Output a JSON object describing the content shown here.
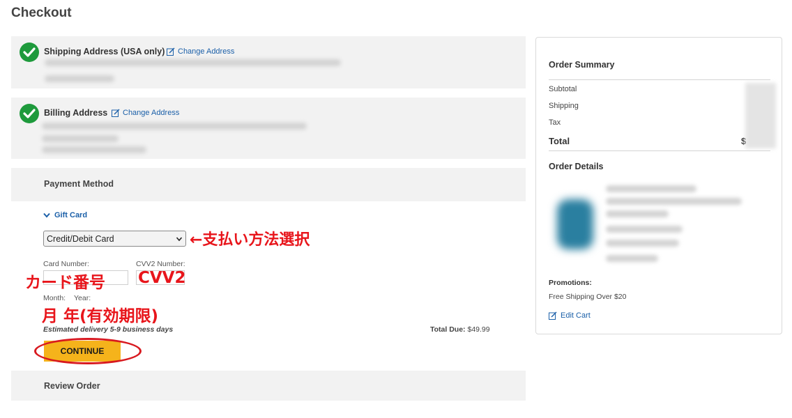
{
  "page": {
    "title": "Checkout"
  },
  "shipping": {
    "title": "Shipping Address (USA only)",
    "change_label": "Change Address"
  },
  "billing": {
    "title": "Billing Address",
    "change_label": "Change Address"
  },
  "payment": {
    "title": "Payment Method",
    "gift_card_label": "Gift Card",
    "method_selected": "Credit/Debit Card",
    "card_number_label": "Card Number:",
    "cvv_label": "CVV2 Number:",
    "month_label": "Month:",
    "year_label": "Year:",
    "delivery_note": "Estimated delivery 5-9 business days",
    "total_due_label": "Total Due:",
    "total_due_value": "$49.99",
    "continue_label": "CONTINUE"
  },
  "review": {
    "title": "Review Order"
  },
  "summary": {
    "title": "Order Summary",
    "subtotal_label": "Subtotal",
    "shipping_label": "Shipping",
    "tax_label": "Tax",
    "total_label": "Total",
    "total_value_partial": "$",
    "order_details_title": "Order Details",
    "promotions_label": "Promotions:",
    "promotion_value": "Free Shipping Over $20",
    "edit_cart_label": "Edit Cart"
  },
  "annotations": {
    "payment_select": "←支払い方法選択",
    "card_number": "カード番号",
    "cvv": "CVV2",
    "expiry": "月 年(有効期限)"
  },
  "colors": {
    "accent": "#1a5fa8",
    "button": "#f5b31b",
    "annotation": "#e8151b",
    "check": "#1e9a3c"
  }
}
